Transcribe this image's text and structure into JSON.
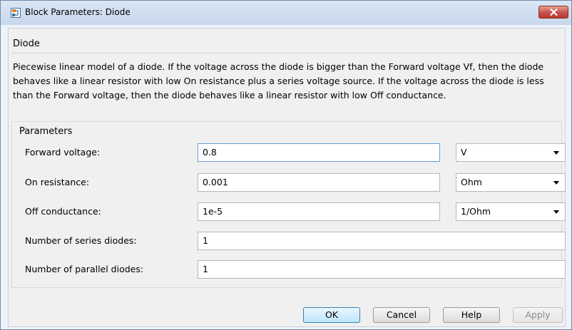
{
  "window": {
    "title": "Block Parameters: Diode"
  },
  "block": {
    "name": "Diode",
    "description": "Piecewise linear model of a diode. If the voltage across the diode is bigger than the Forward voltage Vf, then the diode behaves like a linear resistor with low On resistance plus a series voltage source. If the voltage across the diode is less than the Forward voltage, then the diode behaves like a linear resistor with low Off conductance."
  },
  "parameters": {
    "section_label": "Parameters",
    "forward_voltage": {
      "label": "Forward voltage:",
      "value": "0.8",
      "unit": "V"
    },
    "on_resistance": {
      "label": "On resistance:",
      "value": "0.001",
      "unit": "Ohm"
    },
    "off_conductance": {
      "label": "Off conductance:",
      "value": "1e-5",
      "unit": "1/Ohm"
    },
    "series_diodes": {
      "label": "Number of series diodes:",
      "value": "1"
    },
    "parallel_diodes": {
      "label": "Number of parallel diodes:",
      "value": "1"
    }
  },
  "buttons": {
    "ok": "OK",
    "cancel": "Cancel",
    "help": "Help",
    "apply": "Apply"
  },
  "icons": {
    "app": "simulink-block-icon",
    "close": "close-icon"
  },
  "colors": {
    "close_button": "#c75050",
    "default_button_border": "#3c7fb1",
    "focused_field_border": "#6aa0d8"
  }
}
